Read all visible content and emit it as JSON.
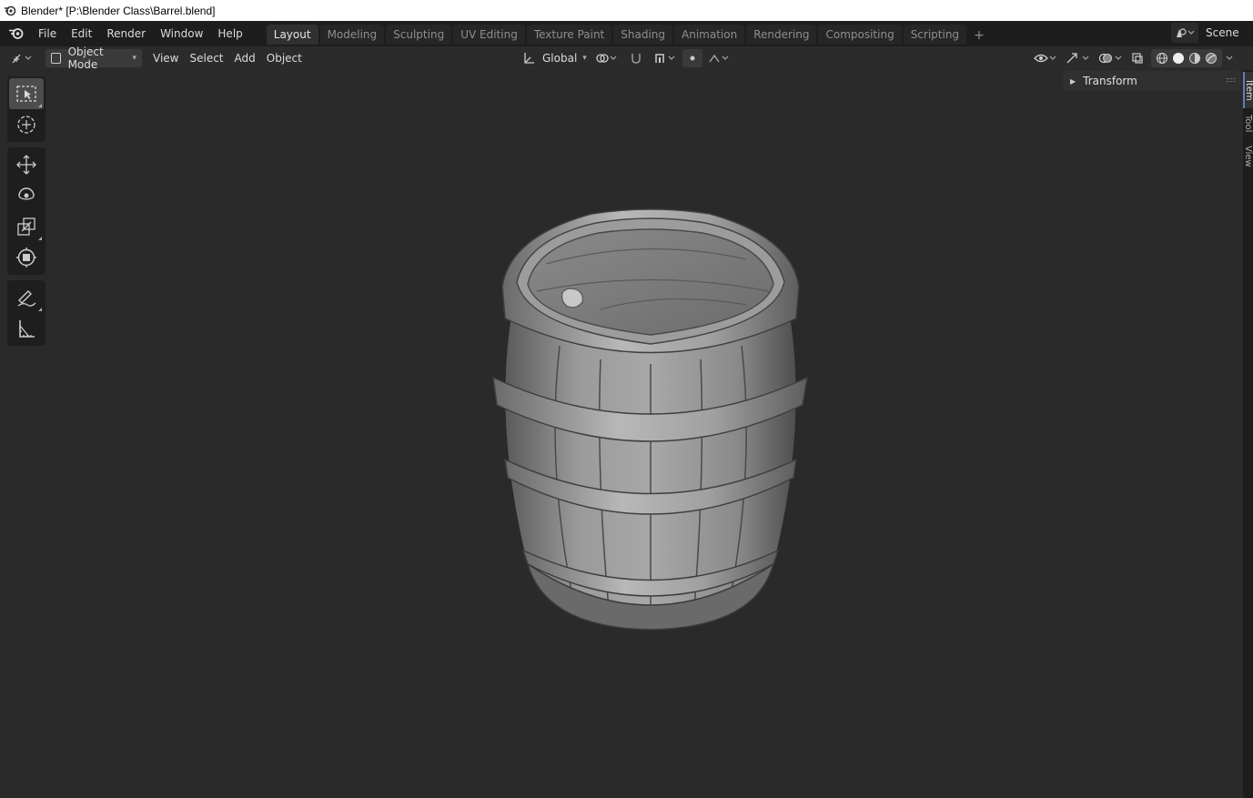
{
  "window": {
    "title": "Blender* [P:\\Blender Class\\Barrel.blend]"
  },
  "menu": {
    "items": [
      "File",
      "Edit",
      "Render",
      "Window",
      "Help"
    ]
  },
  "workspaces": {
    "tabs": [
      "Layout",
      "Modeling",
      "Sculpting",
      "UV Editing",
      "Texture Paint",
      "Shading",
      "Animation",
      "Rendering",
      "Compositing",
      "Scripting"
    ],
    "active": "Layout",
    "add_symbol": "+"
  },
  "scene": {
    "name": "Scene"
  },
  "viewport_header": {
    "mode": "Object Mode",
    "menus": [
      "View",
      "Select",
      "Add",
      "Object"
    ],
    "transform_orientation": "Global"
  },
  "npanel": {
    "section": "Transform",
    "tabs": [
      "Item",
      "Tool",
      "View"
    ],
    "active_tab": "Item"
  },
  "toolbar": {
    "tools": [
      "select-box",
      "cursor",
      "move",
      "rotate",
      "scale",
      "transform",
      "annotate",
      "measure"
    ],
    "active": "select-box"
  },
  "colors": {
    "topbar_bg": "#1d1d1d",
    "header_bg": "#2b2b2b",
    "viewport_bg": "#2a2a2a",
    "active_tab_accent": "#5a7fbf"
  }
}
